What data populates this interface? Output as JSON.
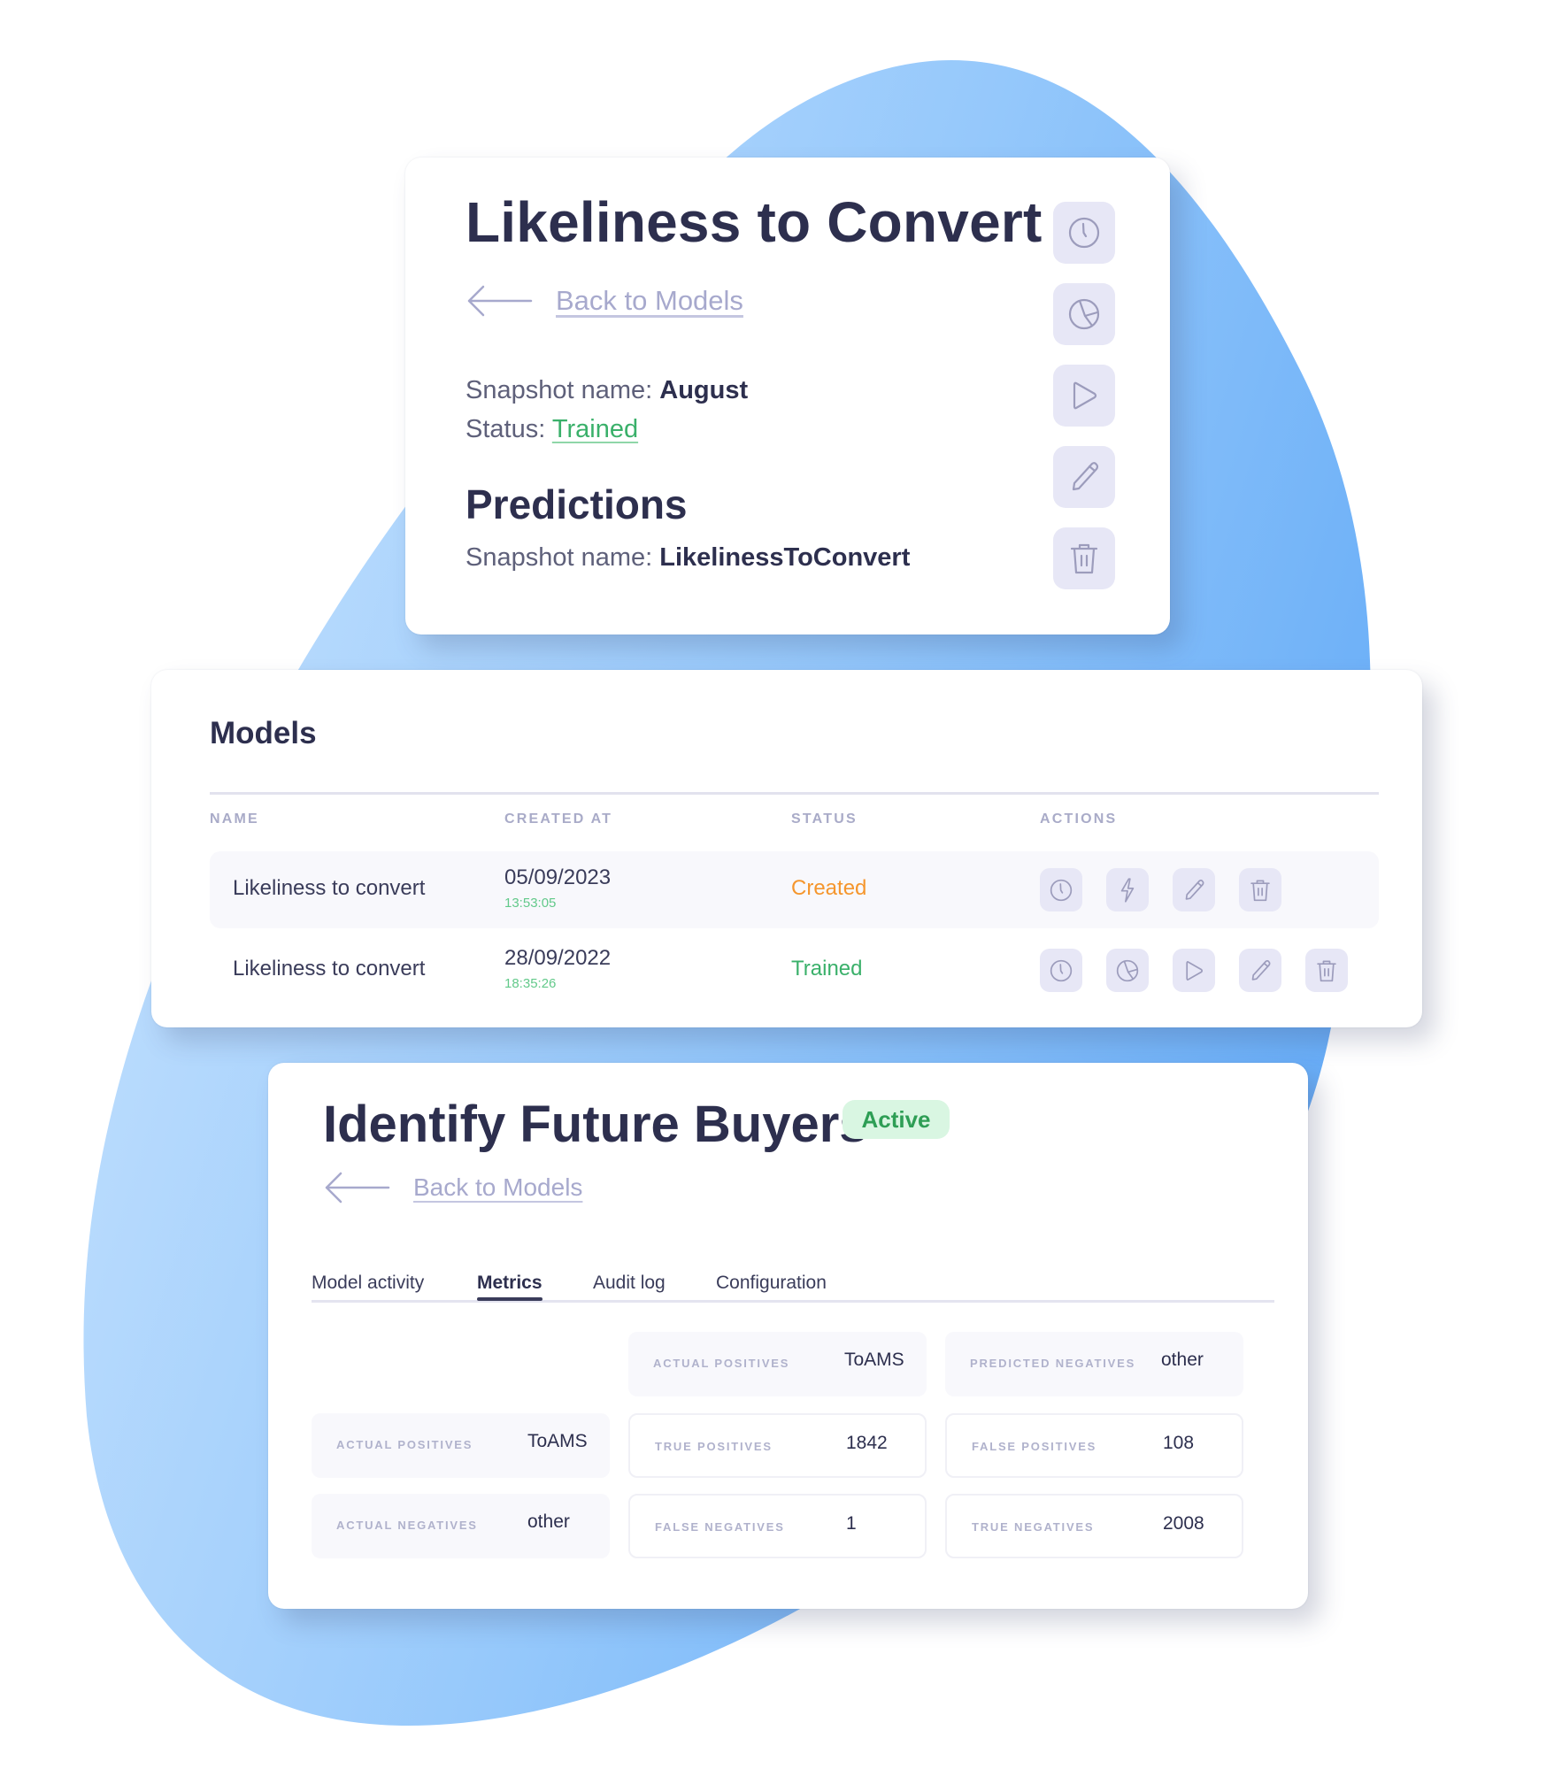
{
  "colors": {
    "title": "#2d2f4e",
    "accent_icon_bg": "#e7e7f6",
    "icon_stroke": "#9c9cbc",
    "link": "#a7a9cd",
    "status_trained": "#3ab06a",
    "status_created": "#f5962d",
    "badge_bg": "#d9f6e2",
    "badge_text": "#2e9e55",
    "blob_light": "#c4e0fe",
    "blob_dark": "#6cb0f8"
  },
  "detail_card": {
    "title": "Likeliness to Convert",
    "back_link": "Back to Models",
    "snapshot_label": "Snapshot name:",
    "snapshot_value": "August",
    "status_label": "Status:",
    "status_value": "Trained",
    "predictions_heading": "Predictions",
    "predictions_snapshot_label": "Snapshot name:",
    "predictions_snapshot_value": "LikelinessToConvert",
    "side_actions": [
      "clock-icon",
      "pie-chart-icon",
      "play-icon",
      "pencil-icon",
      "trash-icon"
    ]
  },
  "models_card": {
    "title": "Models",
    "columns": [
      "NAME",
      "CREATED AT",
      "STATUS",
      "ACTIONS"
    ],
    "rows": [
      {
        "name": "Likeliness to convert",
        "date": "05/09/2023",
        "time": "13:53:05",
        "status": "Created",
        "actions": [
          "clock-icon",
          "lightning-icon",
          "pencil-icon",
          "trash-icon"
        ]
      },
      {
        "name": "Likeliness to convert",
        "date": "28/09/2022",
        "time": "18:35:26",
        "status": "Trained",
        "actions": [
          "clock-icon",
          "pie-chart-icon",
          "play-icon",
          "pencil-icon",
          "trash-icon"
        ]
      }
    ]
  },
  "buyers_card": {
    "title": "Identify Future Buyers",
    "badge": "Active",
    "back_link": "Back to Models",
    "tabs": [
      "Model activity",
      "Metrics",
      "Audit log",
      "Configuration"
    ],
    "active_tab": "Metrics",
    "metrics": {
      "header_row": [
        {
          "label": "ACTUAL POSITIVES",
          "value": "ToAMS"
        },
        {
          "label": "PREDICTED NEGATIVES",
          "value": "other"
        }
      ],
      "row_positive": [
        {
          "label": "ACTUAL POSITIVES",
          "value": "ToAMS"
        },
        {
          "label": "TRUE POSITIVES",
          "value": "1842"
        },
        {
          "label": "FALSE POSITIVES",
          "value": "108"
        }
      ],
      "row_negative": [
        {
          "label": "ACTUAL NEGATIVES",
          "value": "other"
        },
        {
          "label": "FALSE NEGATIVES",
          "value": "1"
        },
        {
          "label": "TRUE NEGATIVES",
          "value": "2008"
        }
      ]
    }
  }
}
